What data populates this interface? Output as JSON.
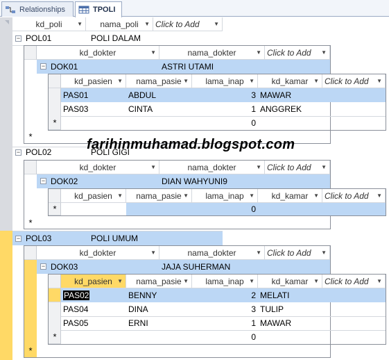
{
  "tabs": [
    {
      "label": "Relationships",
      "icon": "relationships-icon"
    },
    {
      "label": "TPOLI",
      "icon": "table-icon"
    }
  ],
  "top_headers": [
    "kd_poli",
    "nama_poli",
    "Click to Add"
  ],
  "dokter_headers": [
    "kd_dokter",
    "nama_dokter",
    "Click to Add"
  ],
  "pasien_headers": [
    "kd_pasien",
    "nama_pasie",
    "lama_inap",
    "kd_kamar",
    "Click to Add"
  ],
  "poli": [
    {
      "kd_poli": "POL01",
      "nama_poli": "POLI DALAM",
      "dokter": {
        "kd_dokter": "DOK01",
        "nama_dokter": "ASTRI UTAMI"
      },
      "pasien": [
        {
          "kd": "PAS01",
          "nama": "ABDUL",
          "lama": "3",
          "kamar": "MAWAR"
        },
        {
          "kd": "PAS03",
          "nama": "CINTA",
          "lama": "1",
          "kamar": "ANGGREK"
        }
      ],
      "new_row_lama": "0"
    },
    {
      "kd_poli": "POL02",
      "nama_poli": "POLI GIGI",
      "dokter": {
        "kd_dokter": "DOK02",
        "nama_dokter": "DIAN WAHYUNI9"
      },
      "pasien": [],
      "new_row_lama": "0"
    },
    {
      "kd_poli": "POL03",
      "nama_poli": "POLI UMUM",
      "dokter": {
        "kd_dokter": "DOK03",
        "nama_dokter": "JAJA SUHERMAN"
      },
      "pasien": [
        {
          "kd": "PAS02",
          "nama": "BENNY",
          "lama": "2",
          "kamar": "MELATI"
        },
        {
          "kd": "PAS04",
          "nama": "DINA",
          "lama": "3",
          "kamar": "TULIP"
        },
        {
          "kd": "PAS05",
          "nama": "ERNI",
          "lama": "1",
          "kamar": "MAWAR"
        }
      ],
      "new_row_lama": "0"
    }
  ],
  "new_record_symbol": "*",
  "expand_symbol": "−",
  "watermark": "farihinmuhamad.blogspot.com",
  "colors": {
    "selected_row": "#bcd7f5",
    "current_record": "#ffd966",
    "border": "#8a8f99"
  }
}
